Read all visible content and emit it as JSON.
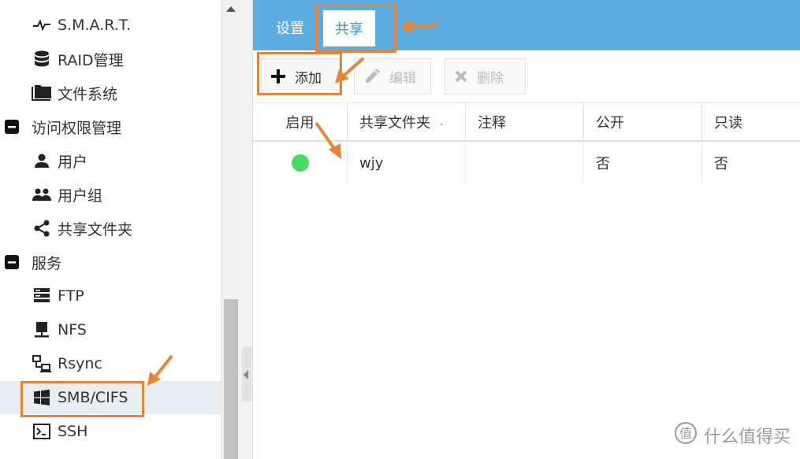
{
  "sidebar": {
    "items": [
      {
        "label": "S.M.A.R.T.",
        "icon": "pulse-icon"
      },
      {
        "label": "RAID管理",
        "icon": "database-icon"
      },
      {
        "label": "文件系统",
        "icon": "folder-icon"
      },
      {
        "label": "访问权限管理",
        "icon": "collapse-minus-icon",
        "group": true
      },
      {
        "label": "用户",
        "icon": "user-icon"
      },
      {
        "label": "用户组",
        "icon": "users-icon"
      },
      {
        "label": "共享文件夹",
        "icon": "share-icon"
      },
      {
        "label": "服务",
        "icon": "collapse-minus-icon",
        "group": true
      },
      {
        "label": "FTP",
        "icon": "server-icon"
      },
      {
        "label": "NFS",
        "icon": "nfs-icon"
      },
      {
        "label": "Rsync",
        "icon": "network-icon"
      },
      {
        "label": "SMB/CIFS",
        "icon": "windows-icon",
        "active": true
      },
      {
        "label": "SSH",
        "icon": "terminal-icon"
      }
    ]
  },
  "tabs": {
    "settings": "设置",
    "share": "共享"
  },
  "toolbar": {
    "add": "添加",
    "edit": "编辑",
    "delete": "删除"
  },
  "table": {
    "headers": {
      "enabled": "启用",
      "folder": "共享文件夹",
      "comment": "注释",
      "public": "公开",
      "readonly": "只读"
    },
    "sort_indicator": ".",
    "rows": [
      {
        "enabled": true,
        "folder": "wjy",
        "comment": "",
        "public": "否",
        "readonly": "否"
      }
    ]
  },
  "watermark": {
    "text": "什么值得买"
  },
  "colors": {
    "accent": "#5dade2",
    "highlight": "#e5853a",
    "enabled_dot": "#4cd964",
    "active_row": "#e8edf1"
  }
}
